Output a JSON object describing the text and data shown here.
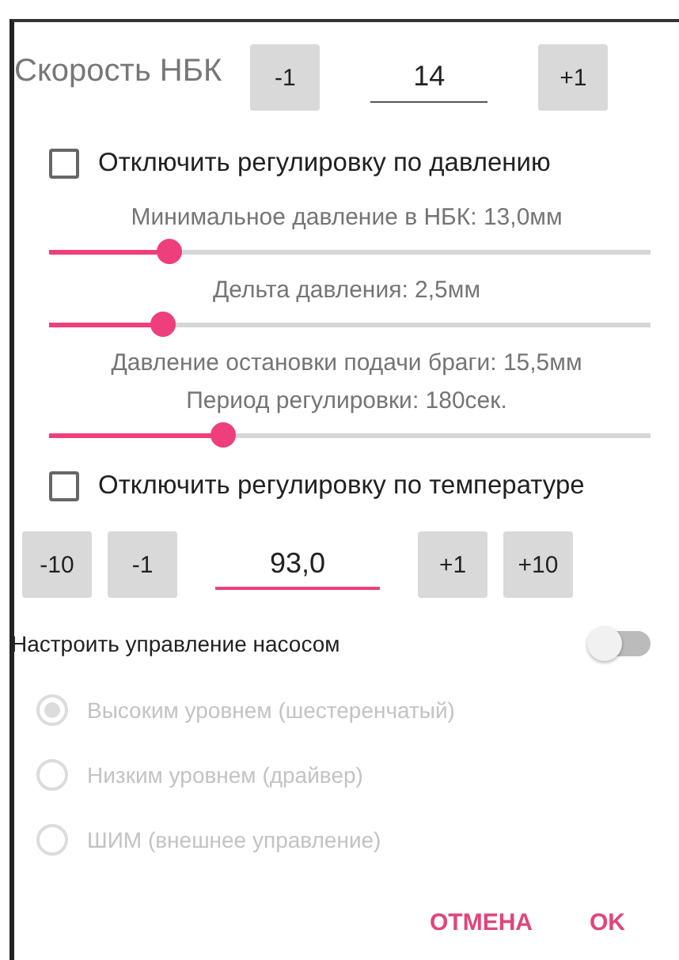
{
  "speed": {
    "label": "Скорость НБК",
    "minus": "-1",
    "value": "14",
    "focused": false,
    "plus": "+1"
  },
  "settings": [
    {
      "kind": "checkbox",
      "label": "Отключить регулировку по давлению",
      "checked": false
    },
    {
      "kind": "slider",
      "label": "Минимальное давление в НБК: 13,0мм",
      "level": 0.2
    },
    {
      "kind": "slider",
      "label": "Дельта давления: 2,5мм",
      "level": 0.19
    },
    {
      "kind": "caption",
      "label": "Давление остановки подачи браги: 15,5мм"
    },
    {
      "kind": "slider",
      "label": "Период регулировки: 180сек.",
      "level": 0.29
    },
    {
      "kind": "checkbox",
      "label": "Отключить регулировку по температуре",
      "checked": false
    }
  ],
  "temperature": {
    "minus": [
      "-10",
      "-1"
    ],
    "value": "93,0",
    "focused": true,
    "plus": [
      "+1",
      "+10"
    ]
  },
  "pump": {
    "label": "Настроить управление насосом",
    "on": false
  },
  "modes": [
    {
      "label": "Высоким уровнем (шестеренчатый)",
      "selected": true,
      "disabled": true
    },
    {
      "label": "Низким уровнем (драйвер)",
      "selected": false,
      "disabled": true
    },
    {
      "label": "ШИМ (внешнее управление)",
      "selected": false,
      "disabled": true
    }
  ],
  "actions": [
    "ОТМЕНА",
    "OK"
  ]
}
